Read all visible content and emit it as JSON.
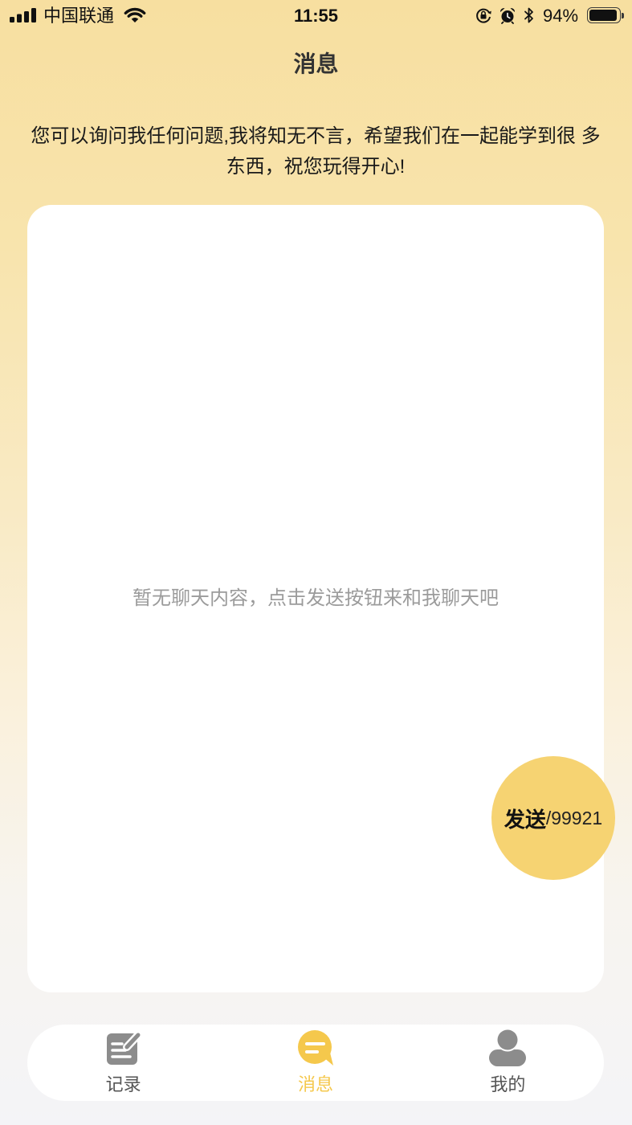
{
  "status_bar": {
    "carrier": "中国联通",
    "time": "11:55",
    "battery_percent": "94%",
    "battery_level": 0.94,
    "icons": [
      "signal-icon",
      "wifi-icon",
      "orientation-lock-icon",
      "alarm-icon",
      "bluetooth-icon",
      "battery-icon"
    ]
  },
  "header": {
    "title": "消息"
  },
  "intro": {
    "text": "您可以询问我任何问题,我将知无不言，希望我们在一起能学到很 多东西，祝您玩得开心!"
  },
  "chat": {
    "empty_text": "暂无聊天内容，点击发送按钮来和我聊天吧"
  },
  "send_button": {
    "label": "发送",
    "count": "/99921"
  },
  "tab_bar": {
    "items": [
      {
        "label": "记录",
        "icon": "record-icon",
        "active": false
      },
      {
        "label": "消息",
        "icon": "message-icon",
        "active": true
      },
      {
        "label": "我的",
        "icon": "profile-icon",
        "active": false
      }
    ]
  },
  "colors": {
    "accent": "#f5c84c",
    "send_button": "#f6d372",
    "icon_inactive": "#8c8c8c"
  }
}
